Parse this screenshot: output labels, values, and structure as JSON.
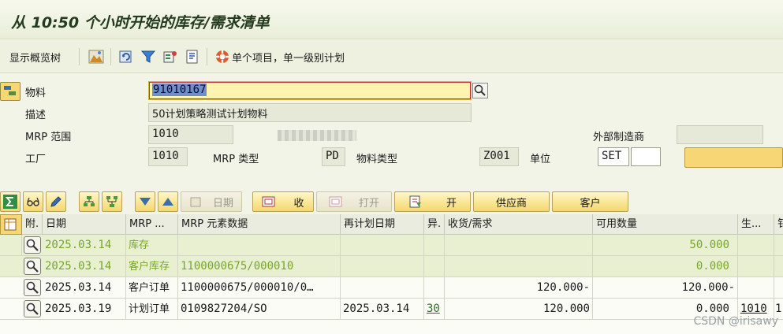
{
  "title": "从 10:50 个小时开始的库存/需求清单",
  "toolbar": {
    "show_overview_tree": "显示概览树",
    "single_item_label": "单个项目，单一级别计划"
  },
  "header_fields": {
    "material_label": "物料",
    "material_value": "91010167",
    "description_label": "描述",
    "description_value": "50计划策略测试计划物料",
    "mrp_area_label": "MRP 范围",
    "mrp_area_value": "1010",
    "external_mfr_label": "外部制造商",
    "plant_label": "工厂",
    "plant_value": "1010",
    "mrp_type_label": "MRP 类型",
    "mrp_type_value": "PD",
    "material_type_label": "物料类型",
    "material_type_value": "Z001",
    "unit_label": "单位",
    "unit_value": "SET"
  },
  "grid_toolbar": {
    "date_button": "日期",
    "receipt_button": "收",
    "open_button": "打开",
    "open2_button": "开",
    "vendor_button": "供应商",
    "customer_button": "客户"
  },
  "table": {
    "columns": [
      "附.",
      "日期",
      "MRP ...",
      "MRP 元素数据",
      "再计划日期",
      "异.",
      "收货/需求",
      "可用数量",
      "生...",
      "钅"
    ],
    "rows": [
      {
        "date": "2025.03.14",
        "element": "库存",
        "data": "",
        "replan": "",
        "exc": "",
        "receipt": "",
        "available": "50.000",
        "prod": "",
        "extra": "",
        "style": "green"
      },
      {
        "date": "2025.03.14",
        "element": "客户库存",
        "data": "1100000675/000010",
        "replan": "",
        "exc": "",
        "receipt": "",
        "available": "0.000",
        "prod": "",
        "extra": "",
        "style": "green"
      },
      {
        "date": "2025.03.14",
        "element": "客户订单",
        "data": "1100000675/000010/0…",
        "replan": "",
        "exc": "",
        "receipt": "120.000-",
        "available": "120.000-",
        "prod": "",
        "extra": "",
        "style": "white"
      },
      {
        "date": "2025.03.19",
        "element": "计划订单",
        "data": "0109827204/SO",
        "replan": "2025.03.14",
        "exc": "30",
        "receipt": "120.000",
        "available": "0.000",
        "prod": "1010",
        "extra": "1",
        "style": "white"
      }
    ]
  },
  "watermark": "CSDN @irisawy",
  "colors": {
    "accent_yellow": "#f7d775",
    "title_text": "#243b1f",
    "green_text": "#78a42c"
  }
}
